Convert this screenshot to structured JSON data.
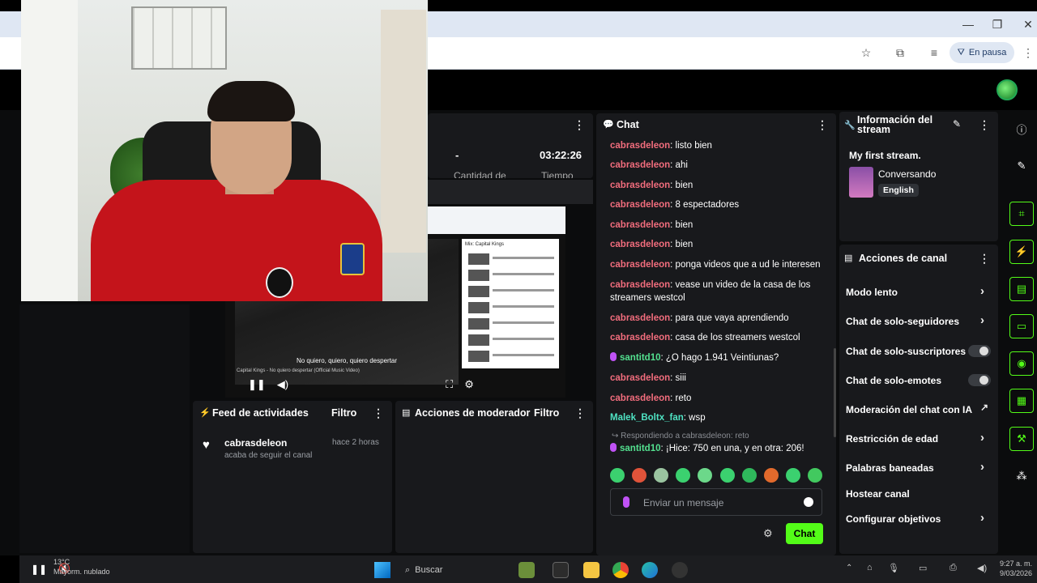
{
  "browser": {
    "status_chip": "En pausa",
    "icons": [
      "minimize-icon",
      "restore-icon",
      "close-icon",
      "star-icon",
      "extensions-icon",
      "media-icon",
      "menu-icon"
    ]
  },
  "stats": {
    "value_1": "-",
    "value_2": "03:22:26",
    "label_1": "Cantidad de",
    "label_2": "Tiempo"
  },
  "preview": {
    "subtitle": "No quiero, quiero, quiero despertar",
    "caption": "Capital Kings - No quiero despertar (Official Music Video)",
    "mix_title": "Mix: Capital Kings"
  },
  "chat": {
    "title": "Chat",
    "messages": [
      {
        "user": "cabrasdeleon",
        "text": "listo bien"
      },
      {
        "user": "cabrasdeleon",
        "text": "ahi"
      },
      {
        "user": "cabrasdeleon",
        "text": "bien"
      },
      {
        "user": "cabrasdeleon",
        "text": "8 espectadores"
      },
      {
        "user": "cabrasdeleon",
        "text": "bien"
      },
      {
        "user": "cabrasdeleon",
        "text": "bien"
      },
      {
        "user": "cabrasdeleon",
        "text": "ponga videos que a ud le interesen"
      },
      {
        "user": "cabrasdeleon",
        "text": "vease un video de la casa de los streamers westcol"
      },
      {
        "user": "cabrasdeleon",
        "text": "para que vaya aprendiendo"
      },
      {
        "user": "cabrasdeleon",
        "text": "casa de los streamers westcol"
      },
      {
        "user": "santitd10",
        "text": "¿O hago 1.941 Veintiunas?"
      },
      {
        "user": "cabrasdeleon",
        "text": "siii"
      },
      {
        "user": "cabrasdeleon",
        "text": "reto"
      },
      {
        "user": "Malek_Boltx_fan",
        "text": "wsp"
      },
      {
        "user": "santitd10",
        "text": "¡Hice: 750 en una, y en otra: 206!"
      }
    ],
    "reply_note": "Respondiendo a cabrasdeleon: reto",
    "input_placeholder": "Enviar un mensaje",
    "send_label": "Chat",
    "colors": {
      "user_red": "#f26d7d",
      "user_green": "#53e08f",
      "accent": "#53fc18"
    }
  },
  "feed": {
    "title": "Feed de actividades",
    "filter_label": "Filtro",
    "item_user": "cabrasdeleon",
    "item_time": "hace 2 horas",
    "item_text": "acaba de seguir el canal"
  },
  "mod": {
    "title": "Acciones de moderador",
    "filter_label": "Filtro"
  },
  "info": {
    "title_line1": "Información del",
    "title_line2": "stream",
    "stream_title": "My first stream.",
    "category": "Conversando",
    "language": "English"
  },
  "actions": {
    "title": "Acciones de canal",
    "items": [
      "Modo lento",
      "Chat de solo-seguidores",
      "Chat de solo-suscriptores",
      "Chat de solo-emotes",
      "Moderación del chat con IA",
      "Restricción de edad",
      "Palabras baneadas",
      "Hostear canal",
      "Configurar objetivos"
    ]
  },
  "taskbar": {
    "search_label": "Buscar",
    "weather_temp": "13°C",
    "weather_desc": "Mayorm. nublado",
    "clock_time": "9:27 a. m.",
    "clock_date": "9/03/2026"
  }
}
